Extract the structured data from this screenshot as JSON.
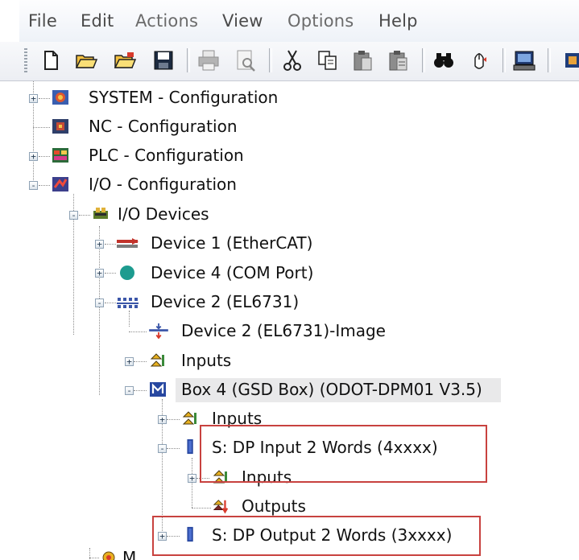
{
  "menu": {
    "items": [
      {
        "label": "File",
        "enabled": true
      },
      {
        "label": "Edit",
        "enabled": true
      },
      {
        "label": "Actions",
        "enabled": false
      },
      {
        "label": "View",
        "enabled": true
      },
      {
        "label": "Options",
        "enabled": false
      },
      {
        "label": "Help",
        "enabled": true
      }
    ]
  },
  "toolbar": {
    "buttons": [
      {
        "icon": "new-file-icon"
      },
      {
        "icon": "open-folder-icon"
      },
      {
        "icon": "open-project-icon"
      },
      {
        "icon": "save-icon"
      },
      {
        "icon": "print-icon"
      },
      {
        "icon": "print-preview-icon"
      },
      {
        "icon": "cut-icon"
      },
      {
        "icon": "copy-icon"
      },
      {
        "icon": "paste-icon"
      },
      {
        "icon": "paste-with-links-icon"
      },
      {
        "icon": "find-icon"
      },
      {
        "icon": "find-next-icon"
      },
      {
        "icon": "target-system-icon"
      }
    ]
  },
  "tree": {
    "nodes": [
      {
        "label": "SYSTEM - Configuration",
        "icon": "system-config-icon",
        "expander": "+"
      },
      {
        "label": "NC - Configuration",
        "icon": "nc-config-icon",
        "expander": ""
      },
      {
        "label": "PLC - Configuration",
        "icon": "plc-config-icon",
        "expander": "+"
      },
      {
        "label": "I/O - Configuration",
        "icon": "io-config-icon",
        "expander": "-"
      },
      {
        "label": "I/O Devices",
        "icon": "io-devices-icon",
        "expander": "-"
      },
      {
        "label": "Device 1 (EtherCAT)",
        "icon": "ethercat-device-icon",
        "expander": "+"
      },
      {
        "label": "Device 4 (COM Port)",
        "icon": "com-port-icon",
        "expander": "+"
      },
      {
        "label": "Device 2 (EL6731)",
        "icon": "profibus-device-icon",
        "expander": "-"
      },
      {
        "label": "Device 2 (EL6731)-Image",
        "icon": "process-image-icon",
        "expander": ""
      },
      {
        "label": "Inputs",
        "icon": "inputs-icon",
        "expander": "+"
      },
      {
        "label": "Box 4 (GSD Box) (ODOT-DPM01 V3.5)",
        "icon": "gsd-box-icon",
        "expander": "-"
      },
      {
        "label": "Inputs",
        "icon": "inputs-icon",
        "expander": "+"
      },
      {
        "label": "S: DP Input 2 Words (4xxxx)",
        "icon": "slot-module-icon",
        "expander": "-"
      },
      {
        "label": "Inputs",
        "icon": "inputs-icon",
        "expander": "+"
      },
      {
        "label": "Outputs",
        "icon": "outputs-icon",
        "expander": ""
      },
      {
        "label": "S: DP Output 2 Words (3xxxx)",
        "icon": "slot-module-icon",
        "expander": "+"
      },
      {
        "label": "M",
        "icon": "mapping-icon",
        "expander": ""
      }
    ]
  },
  "colors": {
    "highlight_border": "#c8423f",
    "selection_bg": "#e9e9ea"
  }
}
